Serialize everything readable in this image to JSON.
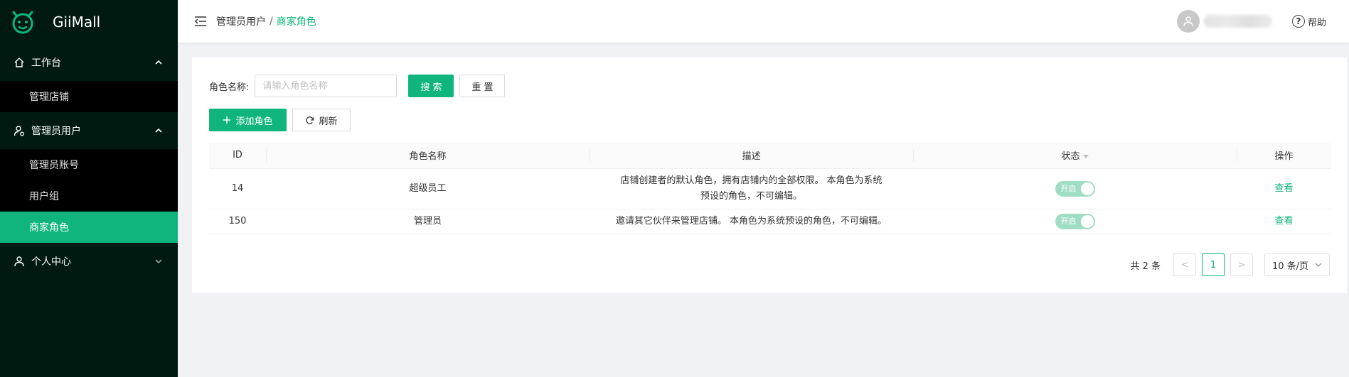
{
  "app": {
    "title": "GiiMall",
    "logo_icon": "cat-logo-icon"
  },
  "colors": {
    "brand": "#0fb57d",
    "sidebar_bg": "#001a12",
    "submenu_bg": "#000000"
  },
  "sidebar": {
    "groups": [
      {
        "label": "工作台",
        "icon": "home-icon",
        "expanded": true,
        "items": [
          {
            "label": "管理店铺",
            "active": false
          }
        ]
      },
      {
        "label": "管理员用户",
        "icon": "user-gear-icon",
        "expanded": true,
        "items": [
          {
            "label": "管理员账号",
            "active": false
          },
          {
            "label": "用户组",
            "active": false
          },
          {
            "label": "商家角色",
            "active": true
          }
        ]
      },
      {
        "label": "个人中心",
        "icon": "user-icon",
        "expanded": false,
        "items": []
      }
    ]
  },
  "header": {
    "breadcrumb": [
      "管理员用户",
      "商家角色"
    ],
    "separator": "/",
    "help_label": "帮助"
  },
  "search": {
    "label": "角色名称:",
    "placeholder": "请输入角色名称",
    "value": "",
    "search_label": "搜 索",
    "reset_label": "重 置"
  },
  "actions": {
    "add_label": "添加角色",
    "refresh_label": "刷新"
  },
  "table": {
    "columns": [
      "ID",
      "角色名称",
      "描述",
      "状态",
      "操作"
    ],
    "rows": [
      {
        "id": "14",
        "name": "超级员工",
        "desc": "店铺创建者的默认角色，拥有店铺内的全部权限。 本角色为系统预设的角色，不可编辑。",
        "status": "开启",
        "status_on": true,
        "action": "查看"
      },
      {
        "id": "150",
        "name": "管理员",
        "desc": "邀请其它伙伴来管理店铺。 本角色为系统预设的角色，不可编辑。",
        "status": "开启",
        "status_on": true,
        "action": "查看"
      }
    ]
  },
  "pagination": {
    "total_text": "共 2 条",
    "prev": "<",
    "next": ">",
    "current_page": "1",
    "page_size": "10 条/页"
  }
}
